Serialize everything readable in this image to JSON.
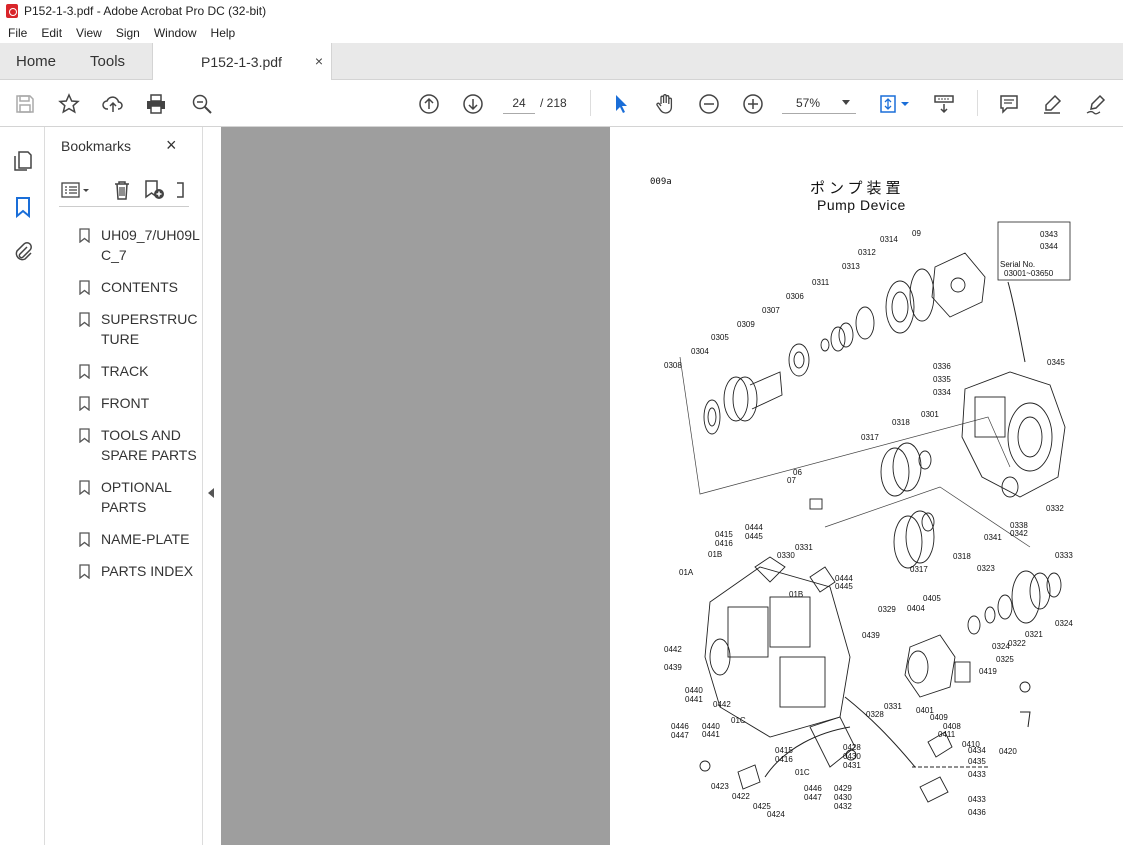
{
  "window": {
    "title": "P152-1-3.pdf - Adobe Acrobat Pro DC (32-bit)"
  },
  "menu": [
    "File",
    "Edit",
    "View",
    "Sign",
    "Window",
    "Help"
  ],
  "tabs": {
    "home": "Home",
    "tools": "Tools",
    "document": "P152-1-3.pdf",
    "close": "×"
  },
  "toolbar": {
    "current_page": "24",
    "page_of": "/ 218",
    "zoom": "57%"
  },
  "bookmarks": {
    "title": "Bookmarks",
    "close": "×",
    "items": [
      "UH09_7/UH09LC_7",
      "CONTENTS",
      "SUPERSTRUCTURE",
      "TRACK",
      "FRONT",
      "TOOLS AND SPARE PARTS",
      "OPTIONAL PARTS",
      "NAME-PLATE",
      "PARTS INDEX"
    ]
  },
  "document_page": {
    "code": "009a",
    "title_jp": "ポンプ装置",
    "title_en": "Pump Device",
    "serial_label": "Serial No.",
    "serial_range": "03001~03650",
    "part_labels": [
      "0343",
      "0344",
      "09",
      "0314",
      "0312",
      "0313",
      "0311",
      "0306",
      "0307",
      "0309",
      "0305",
      "0304",
      "0308",
      "0345",
      "0336",
      "0335",
      "0334",
      "0301",
      "0318",
      "0317",
      "06",
      "07",
      "0332",
      "0338",
      "0342",
      "0341",
      "0333",
      "0318",
      "0317",
      "0323",
      "0324",
      "0321",
      "0322",
      "0324",
      "0325",
      "0415",
      "0416",
      "0444",
      "0445",
      "01B",
      "0330",
      "0331",
      "01A",
      "01B",
      "0444",
      "0445",
      "0329",
      "0405",
      "0404",
      "0439",
      "0419",
      "0442",
      "0439",
      "0440",
      "0441",
      "0442",
      "0331",
      "0328",
      "0401",
      "0409",
      "0408",
      "0411",
      "0410",
      "0420",
      "0446",
      "0447",
      "0440",
      "0441",
      "01C",
      "0415",
      "0416",
      "01C",
      "0428",
      "0430",
      "0431",
      "0434",
      "0435",
      "0433",
      "0423",
      "0422",
      "0425",
      "0424",
      "0446",
      "0447",
      "0429",
      "0430",
      "0432",
      "0433",
      "0436"
    ]
  }
}
